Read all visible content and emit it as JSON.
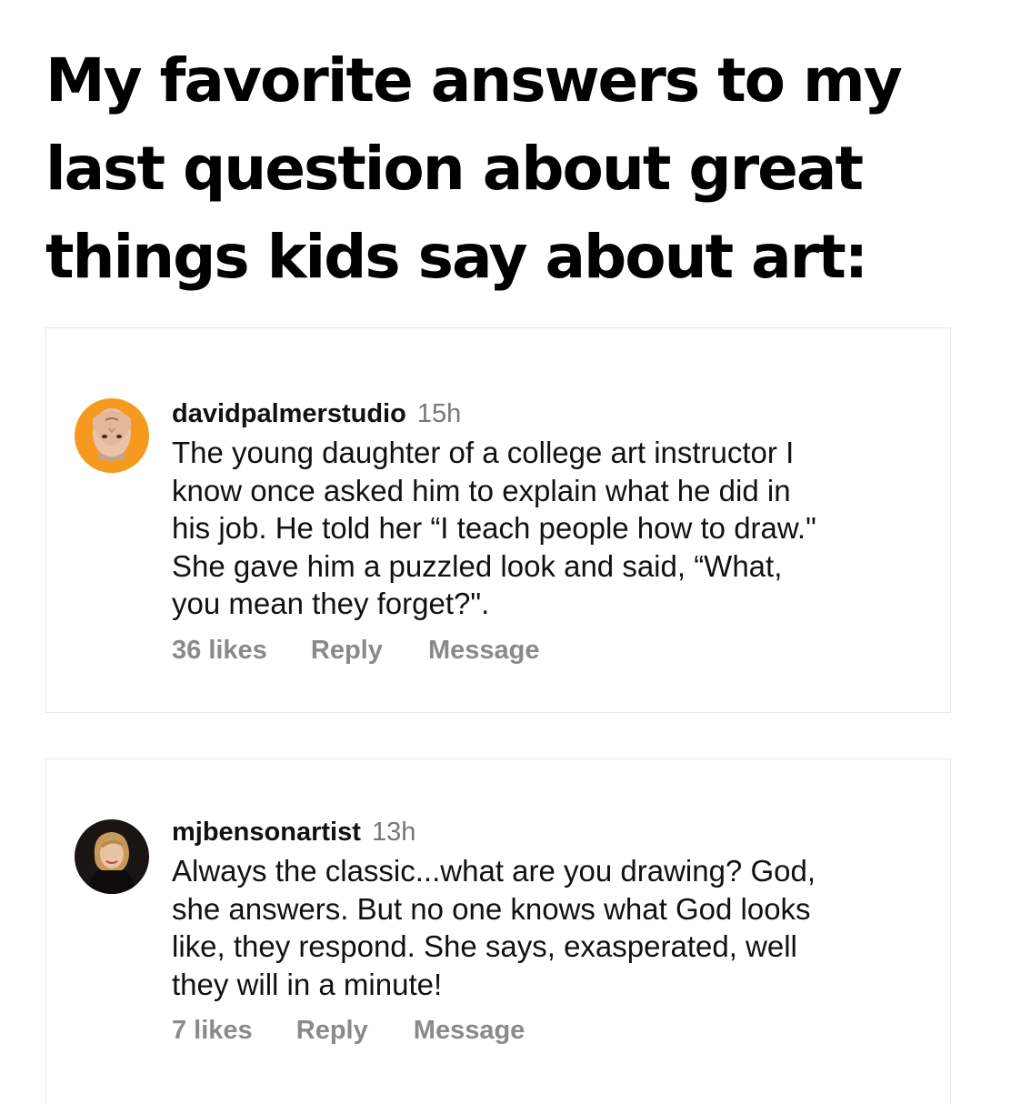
{
  "headline": {
    "lines": [
      "My favorite answers to my",
      "last question about great",
      "things kids say about art:"
    ]
  },
  "comments": [
    {
      "username": "davidpalmerstudio",
      "time": "15h",
      "text_lines": [
        "The young daughter of a college art instructor I",
        "know once asked him to explain what he did in",
        "his job. He told her “I teach people how to draw.\"",
        "She gave him a puzzled look and said, “What,",
        "you mean they forget?\"."
      ],
      "likes": "36 likes",
      "reply_label": "Reply",
      "message_label": "Message",
      "avatar_color": "#f59a1e"
    },
    {
      "username": "mjbensonartist",
      "time": "13h",
      "text_lines": [
        "Always the classic...what are you drawing? God,",
        "she answers. But no one knows what God looks",
        "like, they respond. She says, exasperated, well",
        "they will in a minute!"
      ],
      "likes": "7 likes",
      "reply_label": "Reply",
      "message_label": "Message",
      "avatar_color": "#1a1512"
    }
  ]
}
